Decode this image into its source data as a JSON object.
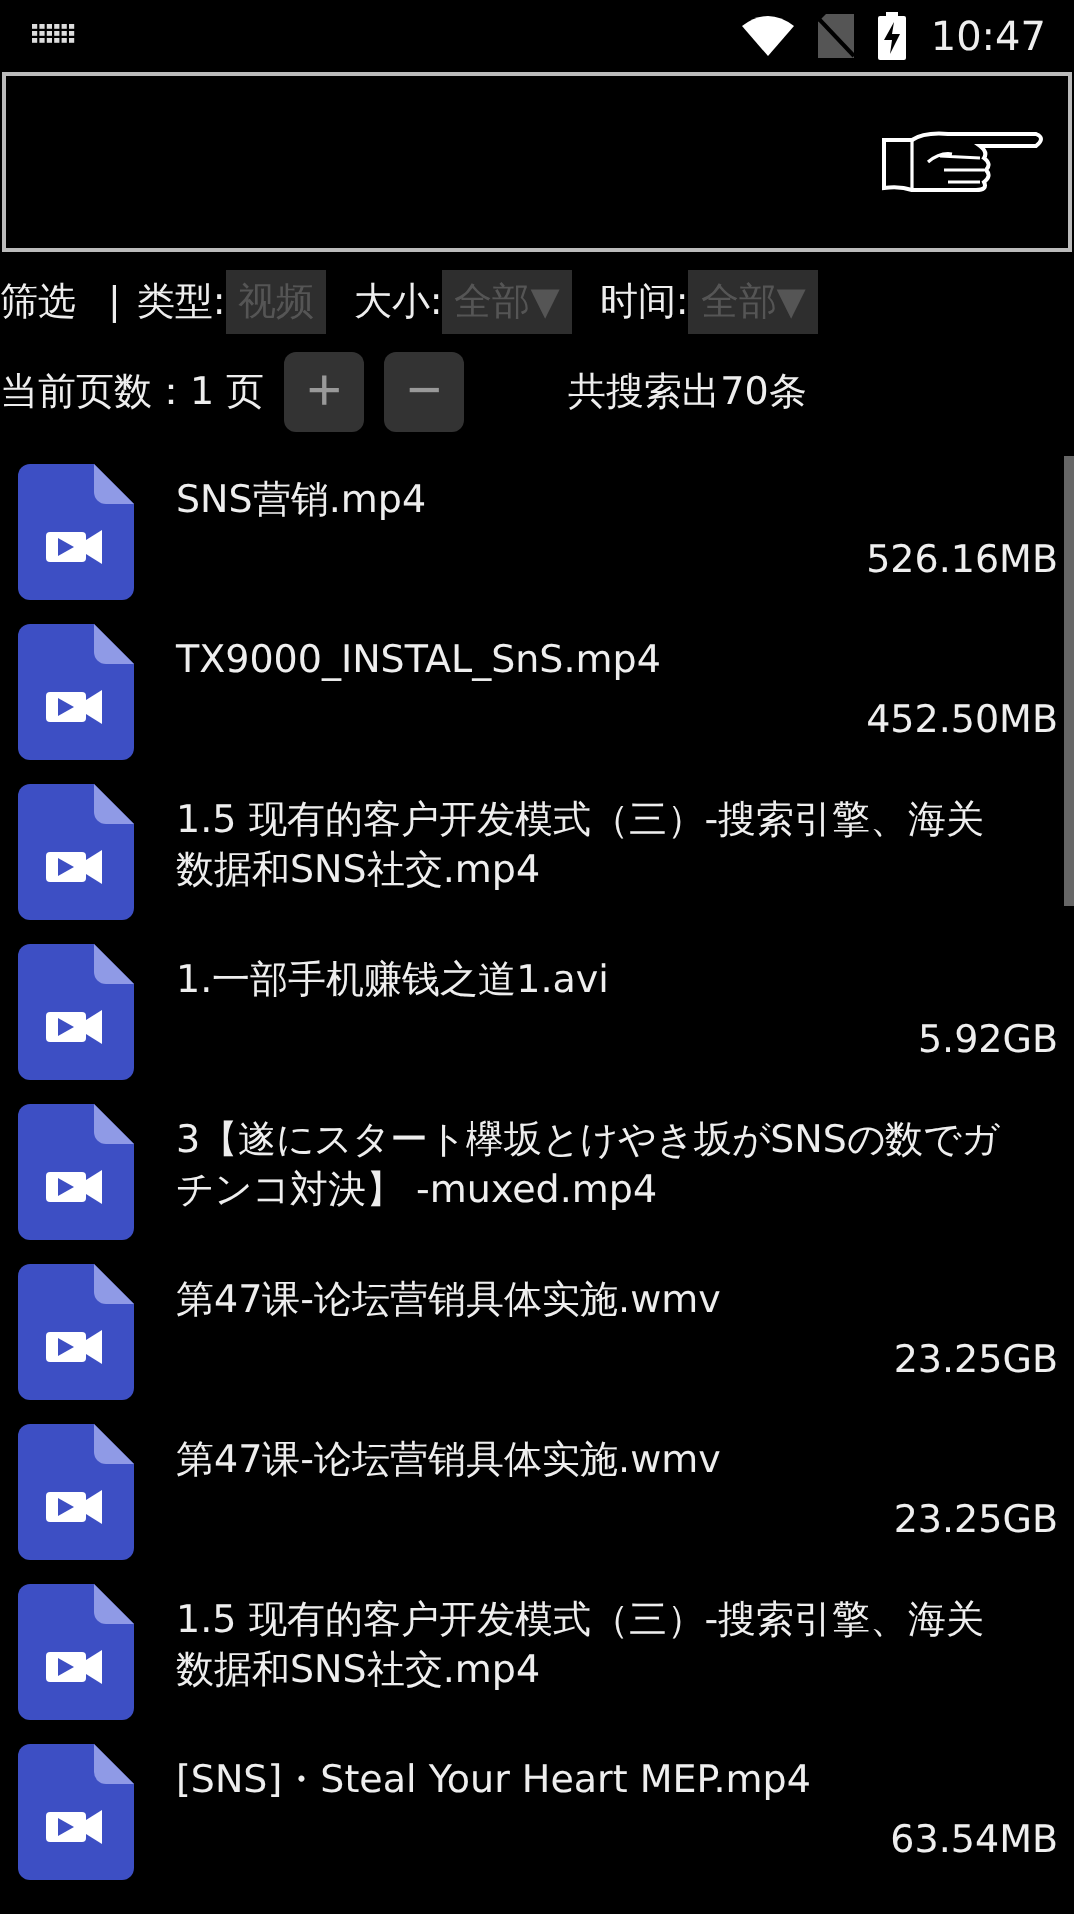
{
  "status_bar": {
    "time": "10:47"
  },
  "filter": {
    "label": "筛选",
    "separator": "|",
    "fields": [
      {
        "label": "类型:",
        "value": "视频"
      },
      {
        "label": "大小:",
        "value": "全部▼"
      },
      {
        "label": "时间:",
        "value": "全部▼"
      }
    ]
  },
  "pager": {
    "page_label": "当前页数：1 页",
    "plus": "+",
    "minus": "−",
    "result_count": "共搜索出70条"
  },
  "files": [
    {
      "name": "SNS营销.mp4",
      "size": "526.16MB"
    },
    {
      "name": "TX9000_INSTAL_SnS.mp4",
      "size": "452.50MB"
    },
    {
      "name": "1.5 现有的客户开发模式（三）-搜索引擎、海关数据和SNS社交.mp4"
    },
    {
      "name": "1.一部手机赚钱之道1.avi",
      "size": "5.92GB"
    },
    {
      "name": "3【遂にスタート欅坂とけやき坂がSNSの数でガチンコ対決】 -muxed.mp4"
    },
    {
      "name": "第47课-论坛营销具体实施.wmv",
      "size": "23.25GB"
    },
    {
      "name": "第47课-论坛营销具体实施.wmv",
      "size": "23.25GB"
    },
    {
      "name": "1.5 现有的客户开发模式（三）-搜索引擎、海关数据和SNS社交.mp4"
    },
    {
      "name": "[SNS]・Steal Your Heart MEP.mp4",
      "size": "63.54MB"
    }
  ]
}
